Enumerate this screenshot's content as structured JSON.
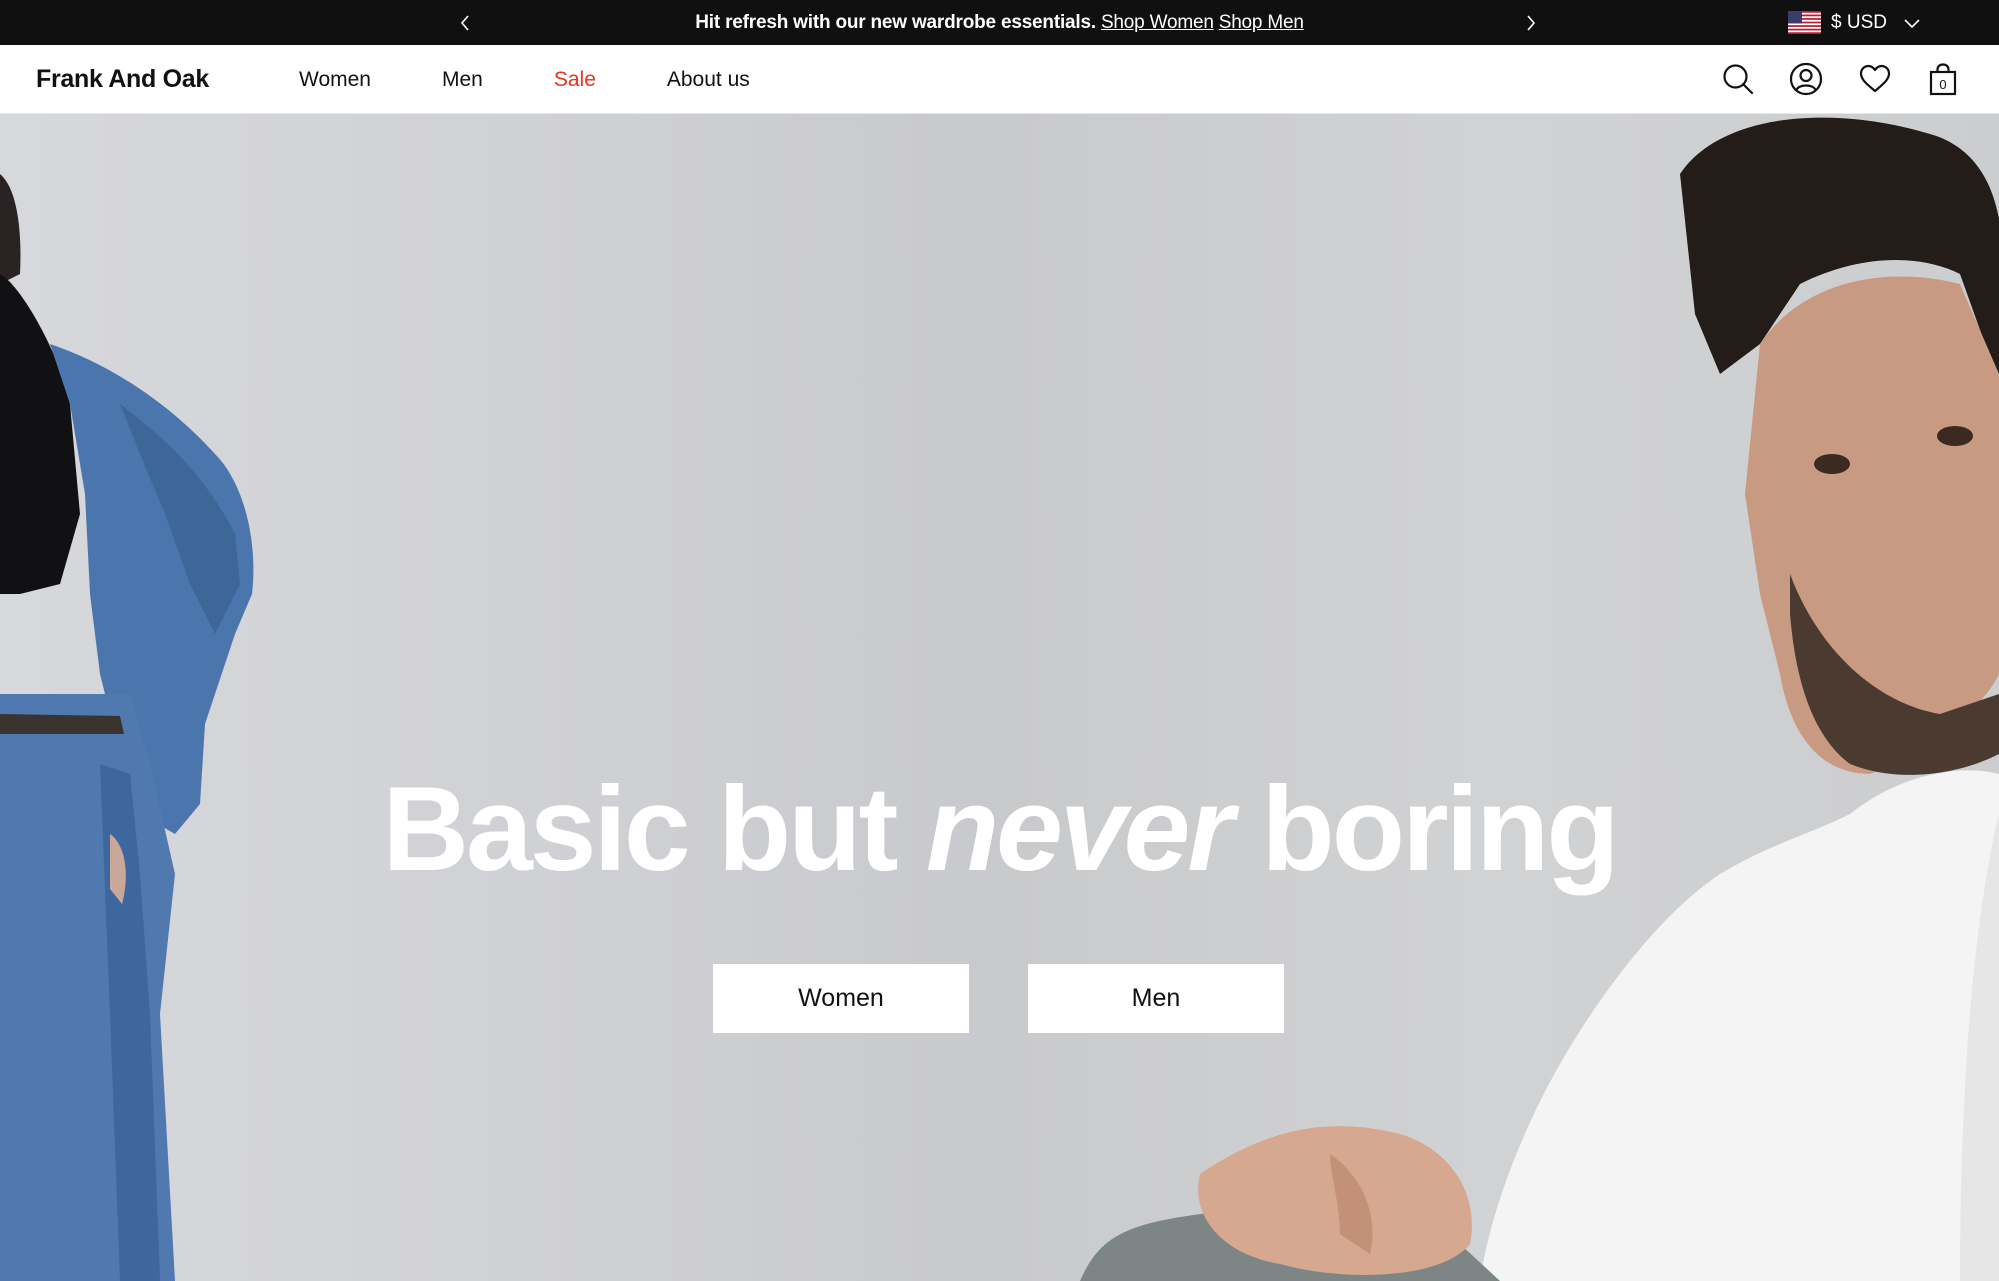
{
  "announcement": {
    "message": "Hit refresh with our new wardrobe essentials.",
    "link_women": "Shop Women",
    "link_men": "Shop Men",
    "currency": "$ USD",
    "flag_icon": "us-flag-icon"
  },
  "header": {
    "logo": "Frank And Oak",
    "nav": [
      {
        "label": "Women"
      },
      {
        "label": "Men"
      },
      {
        "label": "Sale",
        "color": "#e8331e"
      },
      {
        "label": "About us"
      }
    ],
    "cart_count": "0"
  },
  "hero": {
    "headline_start": "Basic but",
    "headline_em": "never",
    "headline_end": "boring",
    "cta_women": "Women",
    "cta_men": "Men"
  },
  "colors": {
    "announcement_bg": "#101010",
    "sale": "#e8331e",
    "hero_bg": "#d0d1d5"
  }
}
